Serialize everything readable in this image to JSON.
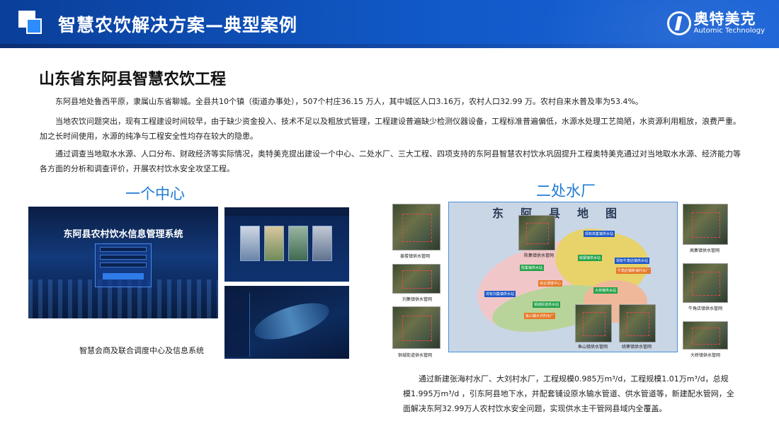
{
  "header": {
    "title": "智慧农饮解决方案—典型案例",
    "brand_cn": "奥特美克",
    "brand_en": "Automic Technology"
  },
  "section": {
    "title": "山东省东阿县智慧农饮工程",
    "paragraphs": [
      "东阿县地处鲁西平原，隶属山东省聊城。全县共10个镇（街道办事处），507个村庄36.15 万人，其中城区人口3.16万，农村人口32.99 万。农村自来水普及率为53.4%。",
      "当地农饮问题突出，现有工程建设时间较早，由于缺少资金投入、技术不足以及粗放式管理，工程建设普遍缺少检测仪器设备，工程标准普遍偏低，水源水处理工艺简陋，水资源利用粗放，浪费严重。加之长时间使用，水源的纯净与工程安全性均存在较大的隐患。",
      "通过调查当地取水水源、人口分布、财政经济等实际情况，奥特美克提出建设一个中心、二处水厂、三大工程、四项支持的东阿县智慧农村饮水巩固提升工程奥特美克通过对当地取水水源、经济能力等各方面的分析和调查评价，开展农村饮水安全攻坚工程。"
    ]
  },
  "left": {
    "subtitle": "一个中心",
    "login_title": "东阿县农村饮水信息管理系统",
    "caption": "智慧会商及联合调度中心及信息系统"
  },
  "right": {
    "subtitle": "二处水厂",
    "map_title": "东阿县地图",
    "sat_labels": {
      "top_left": "姜楼镇供水管网",
      "mid_left": "刘集镇供水管网",
      "low_left": "铜城街道供水管网",
      "inset_top": "陈集镇供水管网",
      "right_top": "高集镇供水管网",
      "right_mid": "牛角店镇供水管网",
      "right_low": "大桥镇供水管网",
      "bottom_a": "鱼山镇供水管网",
      "bottom_b": "姚寨镇供水管网"
    },
    "tags": {
      "t1": "现有高集镇供水站",
      "t2": "姚寨镇供水站",
      "t3": "现有牛角店镇供水站",
      "t4": "牛角店镇新海村水厂",
      "t5": "陈集镇供水站",
      "t6": "综合调度中心",
      "t7": "大桥镇供水站",
      "t8": "鱼山镇大刘村水厂",
      "t9": "铜城街道供水站",
      "t10": "现有刘集镇供水站"
    },
    "description": "通过新建张海村水厂、大刘村水厂，工程规模0.985万m³/d，工程规模1.01万m³/d，总规模1.995万m³/d ，引东阿县地下水，并配套铺设原水输水管道、供水管道等，新建配水管网，全面解决东阿32.99万人农村饮水安全问题，实现供水主干管网县域内全覆盖。"
  },
  "colors": {
    "header_blue": "#1159c8",
    "accent_blue": "#1f7bd8"
  }
}
